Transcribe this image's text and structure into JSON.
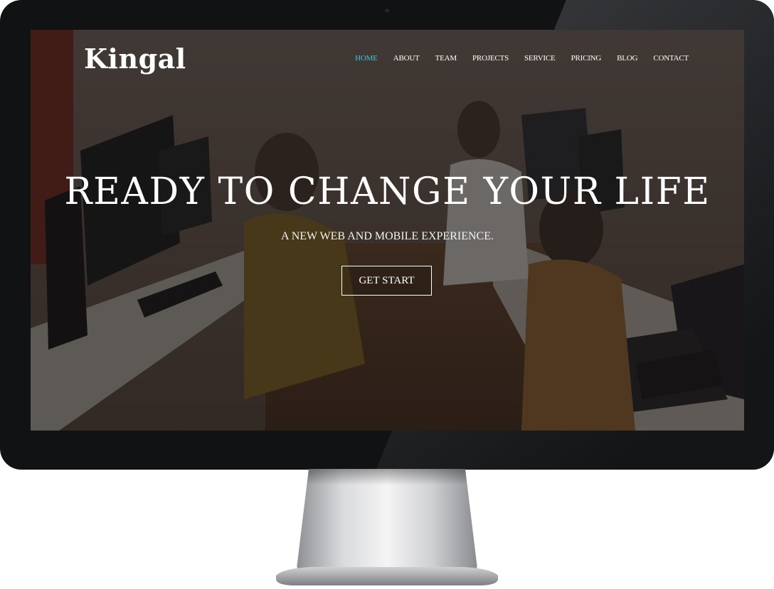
{
  "site": {
    "logo": "Kingal"
  },
  "nav": {
    "items": [
      {
        "label": "HOME",
        "active": true
      },
      {
        "label": "ABOUT",
        "active": false
      },
      {
        "label": "TEAM",
        "active": false
      },
      {
        "label": "PROJECTS",
        "active": false
      },
      {
        "label": "SERVICE",
        "active": false
      },
      {
        "label": "PRICING",
        "active": false
      },
      {
        "label": "BLOG",
        "active": false
      },
      {
        "label": "CONTACT",
        "active": false
      }
    ]
  },
  "hero": {
    "title": "READY TO CHANGE YOUR LIFE",
    "subtitle": "A NEW WEB AND MOBILE EXPERIENCE.",
    "cta_label": "GET START"
  },
  "colors": {
    "accent": "#3fc7d6",
    "bezel": "#111214",
    "text": "#ffffff"
  }
}
